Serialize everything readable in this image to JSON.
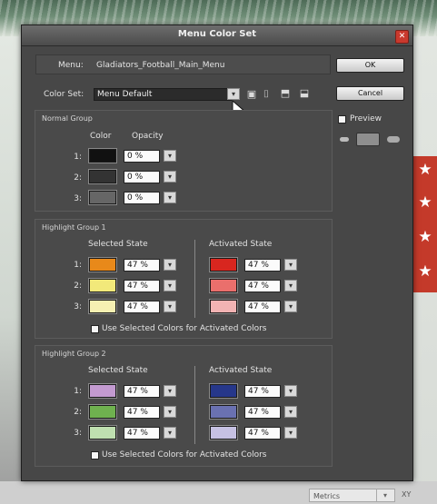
{
  "dialog": {
    "title": "Menu Color Set",
    "menu_label": "Menu:",
    "menu_name": "Gladiators_Football_Main_Menu",
    "color_set_label": "Color Set:",
    "color_set_value": "Menu Default",
    "buttons": {
      "ok": "OK",
      "cancel": "Cancel"
    },
    "preview_label": "Preview"
  },
  "normal_group": {
    "title": "Normal Group",
    "col_color": "Color",
    "col_opacity": "Opacity",
    "rows": [
      {
        "num": "1:",
        "color": "#111111",
        "opacity": "0 %"
      },
      {
        "num": "2:",
        "color": "#333333",
        "opacity": "0 %"
      },
      {
        "num": "3:",
        "color": "#666666",
        "opacity": "0 %"
      }
    ]
  },
  "highlight_group_1": {
    "title": "Highlight Group 1",
    "selected_title": "Selected State",
    "activated_title": "Activated State",
    "selected": [
      {
        "num": "1:",
        "color": "#e8891a",
        "opacity": "47 %"
      },
      {
        "num": "2:",
        "color": "#f2e97a",
        "opacity": "47 %"
      },
      {
        "num": "3:",
        "color": "#f6f0b2",
        "opacity": "47 %"
      }
    ],
    "activated": [
      {
        "color": "#d8261f",
        "opacity": "47 %"
      },
      {
        "color": "#ea6f6c",
        "opacity": "47 %"
      },
      {
        "color": "#f2b3b3",
        "opacity": "47 %"
      }
    ],
    "checkbox_label": "Use Selected Colors for Activated Colors"
  },
  "highlight_group_2": {
    "title": "Highlight Group 2",
    "selected_title": "Selected State",
    "activated_title": "Activated State",
    "selected": [
      {
        "num": "1:",
        "color": "#c39ad0",
        "opacity": "47 %"
      },
      {
        "num": "2:",
        "color": "#6fb14f",
        "opacity": "47 %"
      },
      {
        "num": "3:",
        "color": "#bfe0b0",
        "opacity": "47 %"
      }
    ],
    "activated": [
      {
        "color": "#26378a",
        "opacity": "47 %"
      },
      {
        "color": "#6a71b1",
        "opacity": "47 %"
      },
      {
        "color": "#c6c1e3",
        "opacity": "47 %"
      }
    ],
    "checkbox_label": "Use Selected Colors for Activated Colors"
  },
  "background": {
    "metrics_label": "Metrics",
    "xy_label": "XY"
  },
  "icons": [
    "close-icon",
    "dropdown-arrow-icon",
    "save-icon",
    "delete-icon",
    "import-icon",
    "export-icon",
    "pointer-cursor-icon",
    "star-icon"
  ]
}
